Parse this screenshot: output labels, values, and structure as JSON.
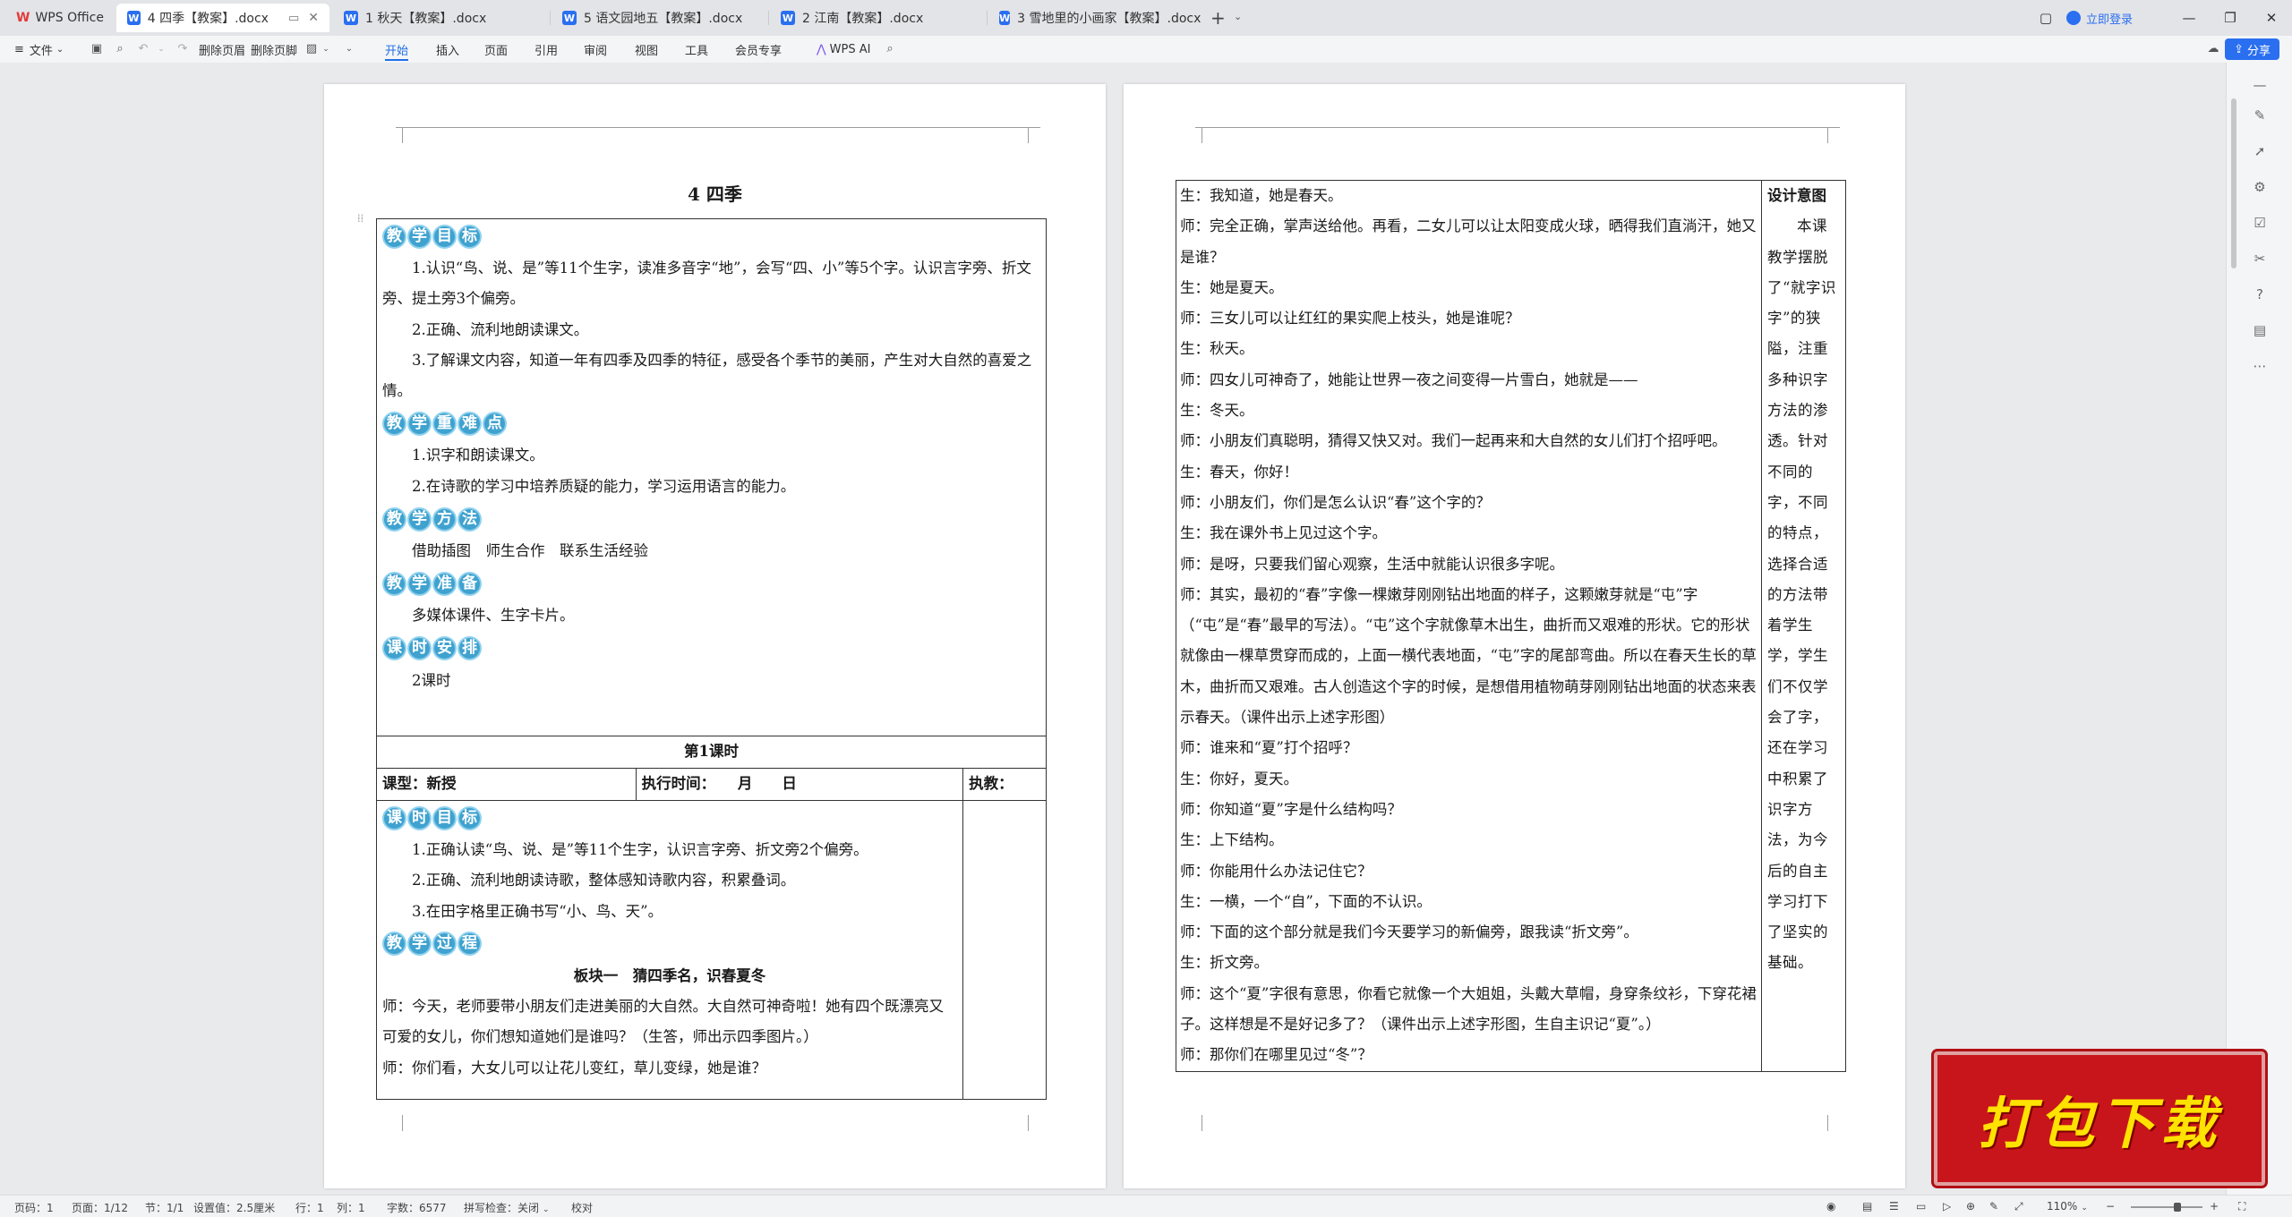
{
  "tabs": [
    {
      "label": "WPS Office",
      "kind": "home"
    },
    {
      "label": "4 四季【教案】.docx",
      "kind": "doc",
      "active": true
    },
    {
      "label": "1 秋天【教案】.docx",
      "kind": "doc"
    },
    {
      "label": "5 语文园地五【教案】.docx",
      "kind": "doc"
    },
    {
      "label": "2 江南【教案】.docx",
      "kind": "doc"
    },
    {
      "label": "3 雪地里的小画家【教案】.docx",
      "kind": "doc"
    }
  ],
  "window": {
    "login_label": "立即登录"
  },
  "ribbon": {
    "file_label": "文件",
    "delete_header_label": "删除页眉",
    "delete_footer_label": "删除页脚",
    "tabs": [
      "开始",
      "插入",
      "页面",
      "引用",
      "审阅",
      "视图",
      "工具",
      "会员专享"
    ],
    "active_tab": "开始",
    "ai_label": "WPS AI",
    "share_label": "分享"
  },
  "page1": {
    "title": "4  四季",
    "sections": {
      "goals": [
        "教",
        "学",
        "目",
        "标"
      ],
      "key_points": [
        "教",
        "学",
        "重",
        "难",
        "点"
      ],
      "methods": [
        "教",
        "学",
        "方",
        "法"
      ],
      "prep": [
        "教",
        "学",
        "准",
        "备"
      ],
      "schedule": [
        "课",
        "时",
        "安",
        "排"
      ],
      "lesson_goals": [
        "课",
        "时",
        "目",
        "标"
      ],
      "process": [
        "教",
        "学",
        "过",
        "程"
      ]
    },
    "goals": [
      "1.认识“鸟、说、是”等11个生字，读准多音字“地”，会写“四、小”等5个字。认识言字旁、折文旁、提土旁3个偏旁。",
      "2.正确、流利地朗读课文。",
      "3.了解课文内容，知道一年有四季及四季的特征，感受各个季节的美丽，产生对大自然的喜爱之情。"
    ],
    "key_points": [
      "1.识字和朗读课文。",
      "2.在诗歌的学习中培养质疑的能力，学习运用语言的能力。"
    ],
    "methods": "借助插图　师生合作　联系生活经验",
    "prep": "多媒体课件、生字卡片。",
    "schedule": "2课时",
    "lesson_heading": "第1课时",
    "lesson_type": "课型：新授",
    "exec_time": "执行时间：　　月　　日",
    "teacher": "执教：",
    "lesson_goals": [
      "1.正确认读“鸟、说、是”等11个生字，认识言字旁、折文旁2个偏旁。",
      "2.正确、流利地朗读诗歌，整体感知诗歌内容，积累叠词。",
      "3.在田字格里正确书写“小、鸟、天”。"
    ],
    "block_heading": "板块一　猜四季名，识春夏冬",
    "dialogue": [
      "师：今天，老师要带小朋友们走进美丽的大自然。大自然可神奇啦！她有四个既漂亮又可爱的女儿，你们想知道她们是谁吗？（生答，师出示四季图片。）",
      "师：你们看，大女儿可以让花儿变红，草儿变绿，她是谁？"
    ]
  },
  "page2": {
    "side_heading": "设计意图",
    "side_text": "本课教学摆脱了“就字识字”的狭隘，注重多种识字方法的渗透。针对不同的字，不同的特点，选择合适的方法带着学生学，学生们不仅学会了字，还在学习中积累了识字方法，为今后的自主学习打下了坚实的基础。",
    "lines": [
      "生：我知道，她是春天。",
      "师：完全正确，掌声送给他。再看，二女儿可以让太阳变成火球，晒得我们直淌汗，她又是谁？",
      "生：她是夏天。",
      "师：三女儿可以让红红的果实爬上枝头，她是谁呢？",
      "生：秋天。",
      "师：四女儿可神奇了，她能让世界一夜之间变得一片雪白，她就是——",
      "生：冬天。",
      "师：小朋友们真聪明，猜得又快又对。我们一起再来和大自然的女儿们打个招呼吧。",
      "生：春天，你好！",
      "师：小朋友们，你们是怎么认识“春”这个字的？",
      "生：我在课外书上见过这个字。",
      "师：是呀，只要我们留心观察，生活中就能认识很多字呢。",
      "师：其实，最初的“春”字像一棵嫩芽刚刚钻出地面的样子，这颗嫩芽就是“屯”字（“屯”是“春”最早的写法）。“屯”这个字就像草木出生，曲折而又艰难的形状。它的形状就像由一棵草贯穿而成的，上面一横代表地面，“屯”字的尾部弯曲。所以在春天生长的草木，曲折而又艰难。古人创造这个字的时候，是想借用植物萌芽刚刚钻出地面的状态来表示春天。（课件出示上述字形图）",
      "师：谁来和“夏”打个招呼？",
      "生：你好，夏天。",
      "师：你知道“夏”字是什么结构吗？",
      "生：上下结构。",
      "师：你能用什么办法记住它？",
      "生：一横，一个“自”，下面的不认识。",
      "师：下面的这个部分就是我们今天要学习的新偏旁，跟我读“折文旁”。",
      "生：折文旁。",
      "师：这个“夏”字很有意思，你看它就像一个大姐姐，头戴大草帽，身穿条纹衫，下穿花裙子。这样想是不是好记多了？（课件出示上述字形图，生自主识记“夏”。）",
      "师：那你们在哪里见过“冬”？"
    ]
  },
  "status": {
    "page_no": "页码：1",
    "page_count": "页面：1/12",
    "section": "节：1/1",
    "settings": "设置值：2.5厘米",
    "row": "行：1",
    "col": "列：1",
    "word_count": "字数：6577",
    "spell_check": "拼写检查：关闭",
    "proofread": "校对",
    "zoom": "110%"
  },
  "banner": {
    "text": "打包下载"
  },
  "colors": {
    "accent": "#2a6ff0",
    "bubble": "#3fa2cf",
    "banner_bg": "#c8151b",
    "banner_text": "#ffe200"
  }
}
